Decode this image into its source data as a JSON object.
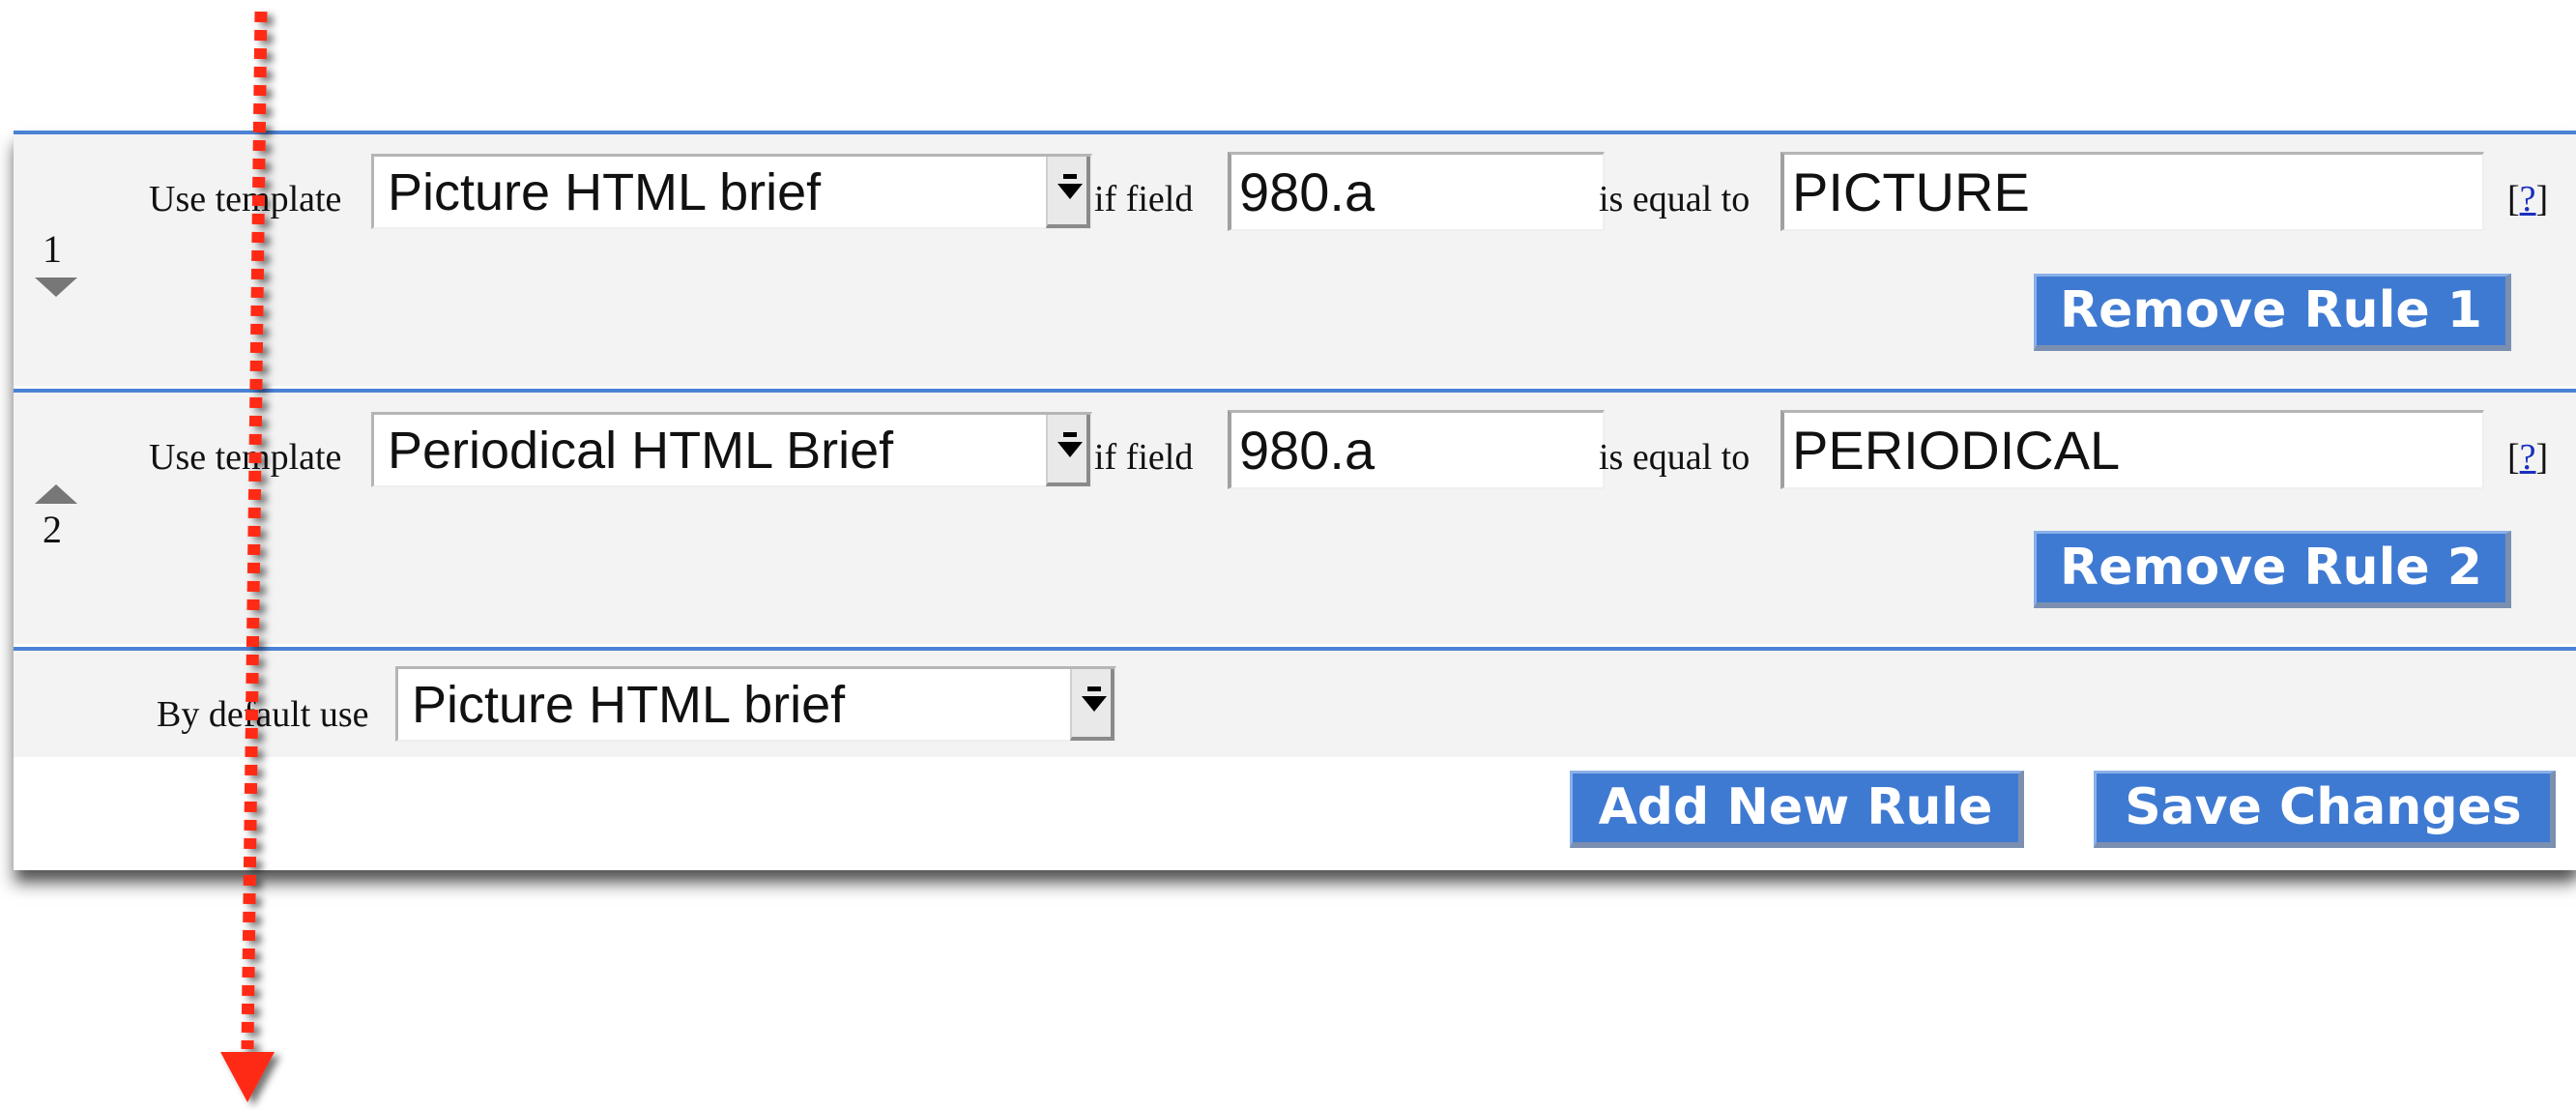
{
  "rules": [
    {
      "number": "1",
      "use_template_label": "Use template",
      "template": "Picture HTML brief",
      "if_field_label": "if field",
      "field": "980.a",
      "equal_label": "is equal to",
      "value": "PICTURE",
      "help_open": "[",
      "help_link": "?",
      "help_close": "]",
      "remove_label": "Remove Rule 1"
    },
    {
      "number": "2",
      "use_template_label": "Use template",
      "template": "Periodical HTML Brief",
      "if_field_label": "if field",
      "field": "980.a",
      "equal_label": "is equal to",
      "value": "PERIODICAL",
      "help_open": "[",
      "help_link": "?",
      "help_close": "]",
      "remove_label": "Remove Rule 2"
    }
  ],
  "default": {
    "label": "By default use",
    "template": "Picture HTML brief"
  },
  "actions": {
    "add_label": "Add New Rule",
    "save_label": "Save Changes"
  },
  "colors": {
    "accent": "#3f7ad2",
    "rule_border": "#4b82d4",
    "panel_bg": "#f3f3f3",
    "annotation_arrow": "#ff2a12"
  },
  "icons": {
    "move_down": "triangle-down-icon",
    "move_up": "triangle-up-icon",
    "dropdown": "chevron-down-icon",
    "annotation": "dotted-arrow-down-icon"
  }
}
